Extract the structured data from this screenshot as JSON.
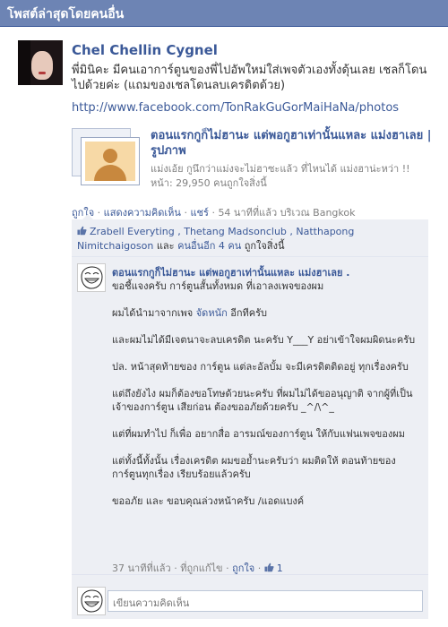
{
  "header": {
    "title": "โพสต์ล่าสุดโดยคนอื่น"
  },
  "post": {
    "author": "Chel Chellin Cygnel",
    "text": "พี่มินิคะ มีคนเอาการ์ตูนของพี่ไปอัพใหม่ใส่เพจตัวเองทั้งดุ้นเลย เชลก็โดนไปด้วยค่ะ (แถมของเชลโดนลบเครดิตด้วย)",
    "link": "http://www.facebook.com/TonRakGuGorMaiHaNa/photos"
  },
  "shared": {
    "title": "ตอนแรกกูก็ไม่ฮานะ แต่พอกูฮาเท่านั้นแหละ แม่งฮาเลย | รูปภาพ",
    "description": "แม่งเอ้ย กูนึกว่าแม่งจะไม่ฮาซะแล้ว ที่ไหนได้ แม่งฮาน่ะหว่า !!",
    "likes_label": "หน้า: 29,950 คนถูกใจสิ่งนี้"
  },
  "actions": {
    "like": "ถูกใจ",
    "comment": "แสดงความคิดเห็น",
    "share": "แชร์",
    "time": "54 นาทีที่แล้ว บริเวณ Bangkok",
    "sep": "·"
  },
  "likes": {
    "names": "Zrabell Everyting , Thetang Madsonclub , Natthapong Nimitchaigoson",
    "and": "และ",
    "others": "คนอื่นอีก 4 คน",
    "suffix": "ถูกใจสิ่งนี้"
  },
  "comment": {
    "author": "ตอนแรกกูก็ไม่ฮานะ แต่พอกูฮาเท่านั้นแหละ แม่งฮาเลย .",
    "p1": "ขอชี้แจงครับ การ์ตูนสั้นทั้งหมด ที่เอาลงเพจของผม",
    "p2_pre": "ผมได้นำมาจากเพจ",
    "p2_link": "จัดหนัก",
    "p2_post": "อีกทีครับ",
    "p3": "และผมไม่ได้มีเจตนาจะลบเครดิต นะครับ Y___Y อย่าเข้าใจผมผิดนะครับ",
    "p4": "ปล. หน้าสุดท้ายของ การ์ตูน แต่ละอัลบั้ม จะมีเครดิตติดอยู่ ทุกเรื่องครับ",
    "p5": "แต่ถึงยังไง ผมก็ต้องขอโทษด้วยนะครับ ที่ผมไม่ได้ขออนุญาติ จากผู้ที่เป็นเจ้าของการ์ตูน เสียก่อน ต้องขออภัยด้วยครับ _^/\\^_",
    "p6": "แต่ที่ผมทำไป ก็เพื่อ อยากสื่อ อารมณ์ของการ์ตูน ให้กับแฟนเพจของผม",
    "p7": "แต่ทั้งนี้ทั้งนั้น เรื่องเครดิต ผมขอย้ำนะครับว่า ผมติดให้ ตอนท้ายของการ์ตูนทุกเรื่อง เรียบร้อยแล้วครับ",
    "p8": "ขออภัย และ ขอบคุณล่วงหน้าครับ /แอดแบงค์",
    "time": "37 นาทีที่แล้ว",
    "unlike": "ที่ถูกแก้ไข",
    "like": "ถูกใจ",
    "like_count": "1"
  },
  "write": {
    "placeholder": "เขียนความคิดเห็น"
  },
  "colors": {
    "brand": "#3b5998",
    "header": "#6d84b4",
    "ufi_bg": "#edeff4"
  }
}
